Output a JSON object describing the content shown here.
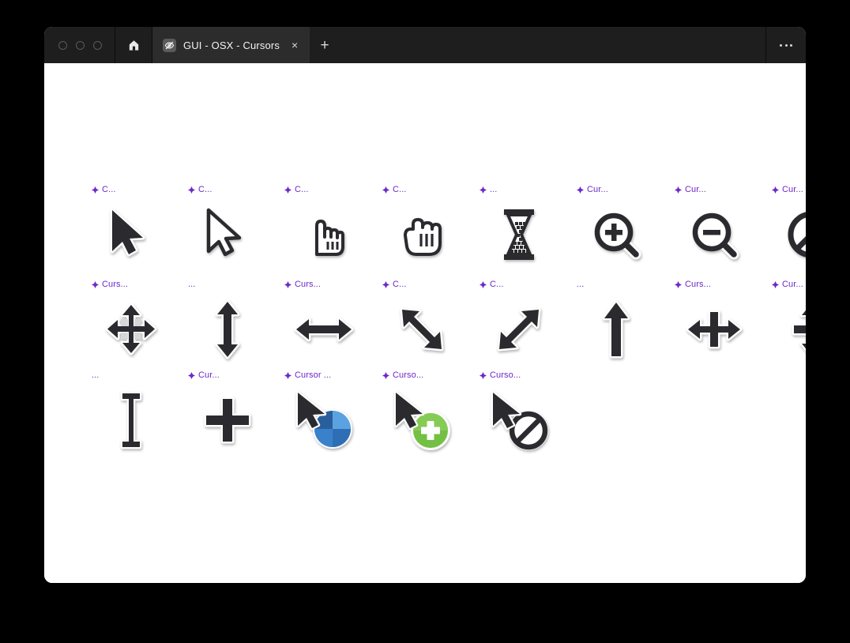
{
  "window": {
    "titlebar": {
      "traffic_lights": [
        "close",
        "minimize",
        "maximize"
      ],
      "home_icon": "home-icon",
      "tab": {
        "favicon": "eye-off-icon",
        "title": "GUI - OSX - Cursors",
        "close_label": "×"
      },
      "new_tab_label": "+",
      "more_label": "more-horizontal-icon"
    }
  },
  "colors": {
    "page_background": "#000000",
    "window_background": "#ffffff",
    "titlebar_background": "#1e1e1e",
    "tab_active_background": "#2c2c2c",
    "label_purple": "#6d28c9",
    "cursor_ink": "#2b2b2f",
    "beachball_blue": "#3d86d0",
    "copy_green": "#74c044"
  },
  "canvas": {
    "rows": [
      [
        {
          "name": "arrow-filled-cursor",
          "label": "C...",
          "has_label_icon": true,
          "icon": "arrow-filled"
        },
        {
          "name": "arrow-outline-cursor",
          "label": "C...",
          "has_label_icon": true,
          "icon": "arrow-outline"
        },
        {
          "name": "pointing-hand-cursor",
          "label": "C...",
          "has_label_icon": true,
          "icon": "pointing-hand"
        },
        {
          "name": "closed-hand-cursor",
          "label": "C...",
          "has_label_icon": true,
          "icon": "closed-hand"
        },
        {
          "name": "hourglass-busy-cursor",
          "label": "...",
          "has_label_icon": true,
          "icon": "hourglass"
        },
        {
          "name": "zoom-in-cursor",
          "label": "Cur...",
          "has_label_icon": true,
          "icon": "zoom-in"
        },
        {
          "name": "zoom-out-cursor",
          "label": "Cur...",
          "has_label_icon": true,
          "icon": "zoom-out"
        },
        {
          "name": "not-allowed-cursor",
          "label": "Cur...",
          "has_label_icon": true,
          "icon": "not-allowed"
        }
      ],
      [
        {
          "name": "move-all-cursor",
          "label": "Curs...",
          "has_label_icon": true,
          "icon": "move-four-way"
        },
        {
          "name": "resize-vertical-cursor",
          "label": "...",
          "has_label_icon": false,
          "icon": "resize-vertical"
        },
        {
          "name": "resize-horizontal-cursor",
          "label": "Curs...",
          "has_label_icon": true,
          "icon": "resize-horizontal"
        },
        {
          "name": "resize-nwse-cursor",
          "label": "C...",
          "has_label_icon": true,
          "icon": "resize-nwse"
        },
        {
          "name": "resize-nesw-cursor",
          "label": "C...",
          "has_label_icon": true,
          "icon": "resize-nesw"
        },
        {
          "name": "arrow-up-cursor",
          "label": "...",
          "has_label_icon": false,
          "icon": "arrow-up"
        },
        {
          "name": "resize-column-cursor",
          "label": "Curs...",
          "has_label_icon": true,
          "icon": "resize-column"
        },
        {
          "name": "resize-row-cursor",
          "label": "Cur...",
          "has_label_icon": true,
          "icon": "resize-row"
        }
      ],
      [
        {
          "name": "text-ibeam-cursor",
          "label": "...",
          "has_label_icon": false,
          "icon": "ibeam"
        },
        {
          "name": "crosshair-cursor",
          "label": "Cur...",
          "has_label_icon": true,
          "icon": "crosshair"
        },
        {
          "name": "busy-beachball-cursor",
          "label": "Cursor ...",
          "has_label_icon": true,
          "icon": "arrow-beachball"
        },
        {
          "name": "copy-drag-cursor",
          "label": "Curso...",
          "has_label_icon": true,
          "icon": "arrow-copy"
        },
        {
          "name": "no-drop-cursor",
          "label": "Curso...",
          "has_label_icon": true,
          "icon": "arrow-nodrop"
        }
      ]
    ]
  }
}
